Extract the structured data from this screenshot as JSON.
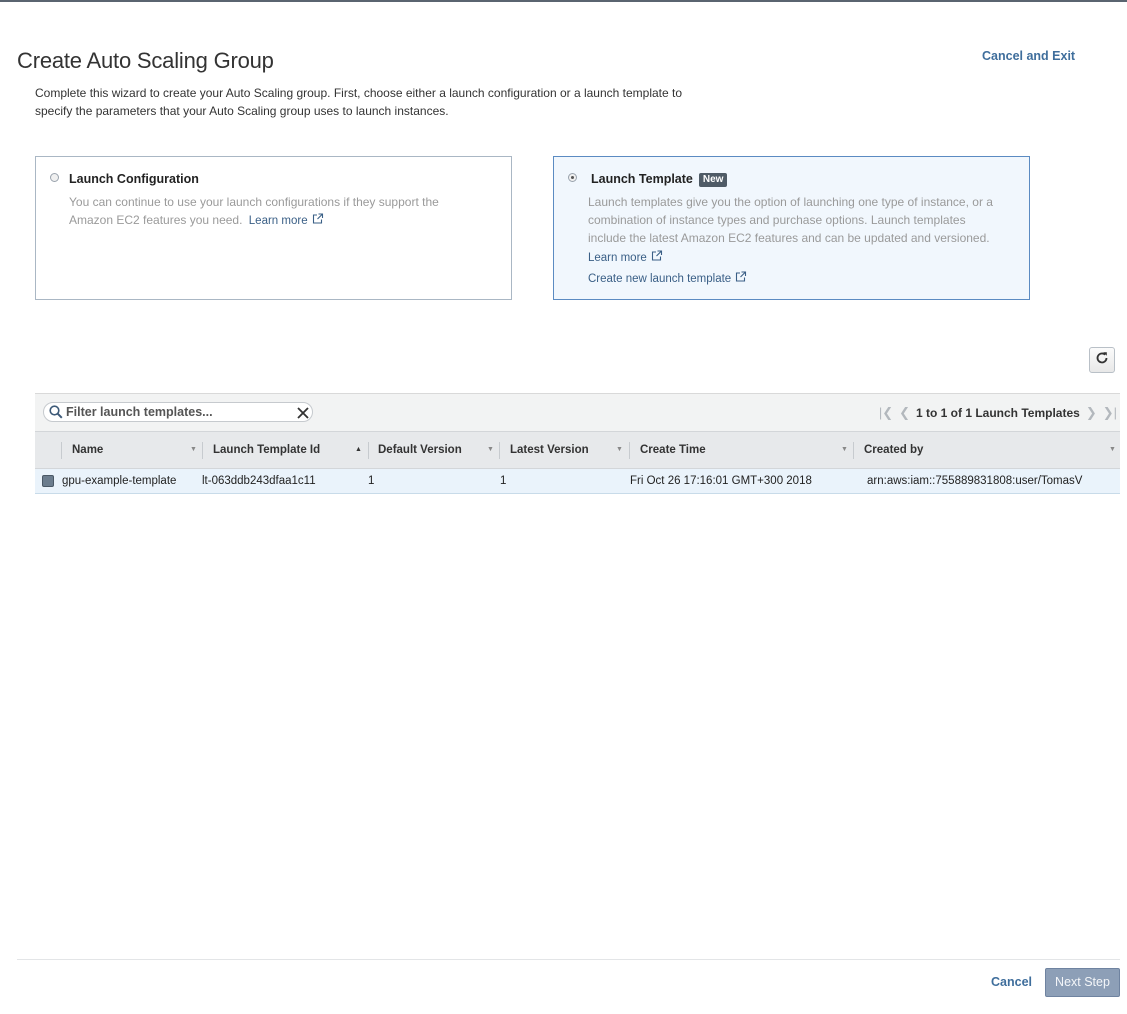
{
  "page": {
    "title": "Create Auto Scaling Group",
    "cancel_exit": "Cancel and Exit",
    "intro_line1": "Complete this wizard to create your Auto Scaling group. First, choose either a launch configuration or a launch template to",
    "intro_line2": "specify the parameters that your Auto Scaling group uses to launch instances."
  },
  "options": {
    "launch_configuration": {
      "title": "Launch Configuration",
      "desc_line1": "You can continue to use your launch configurations if they support the",
      "desc_line2": "Amazon EC2 features you need.",
      "learn_more": "Learn more",
      "selected": false
    },
    "launch_template": {
      "title": "Launch Template",
      "badge": "New",
      "desc_line1": "Launch templates give you the option of launching one type of instance, or a",
      "desc_line2": "combination of instance types and purchase options. Launch templates",
      "desc_line3": "include the latest Amazon EC2 features and can be updated and versioned.",
      "learn_more": "Learn more",
      "create_link": "Create new launch template",
      "selected": true
    }
  },
  "table": {
    "filter_placeholder": "Filter launch templates...",
    "pagination": "1 to 1 of 1 Launch Templates",
    "columns": [
      "Name",
      "Launch Template Id",
      "Default Version",
      "Latest Version",
      "Create Time",
      "Created by"
    ],
    "rows": [
      {
        "name": "gpu-example-template",
        "id": "lt-063ddb243dfaa1c11",
        "default_version": "1",
        "latest_version": "1",
        "create_time": "Fri Oct 26 17:16:01 GMT+300 2018",
        "created_by": "arn:aws:iam::755889831808:user/TomasV"
      }
    ]
  },
  "footer": {
    "cancel": "Cancel",
    "next": "Next Step"
  },
  "colors": {
    "link": "#3f6e9c",
    "selected_card_border": "#5b8bc2",
    "selected_card_bg": "#f1f7fd",
    "badge_bg": "#4f5b66",
    "next_button_bg": "#8d9fb7"
  }
}
